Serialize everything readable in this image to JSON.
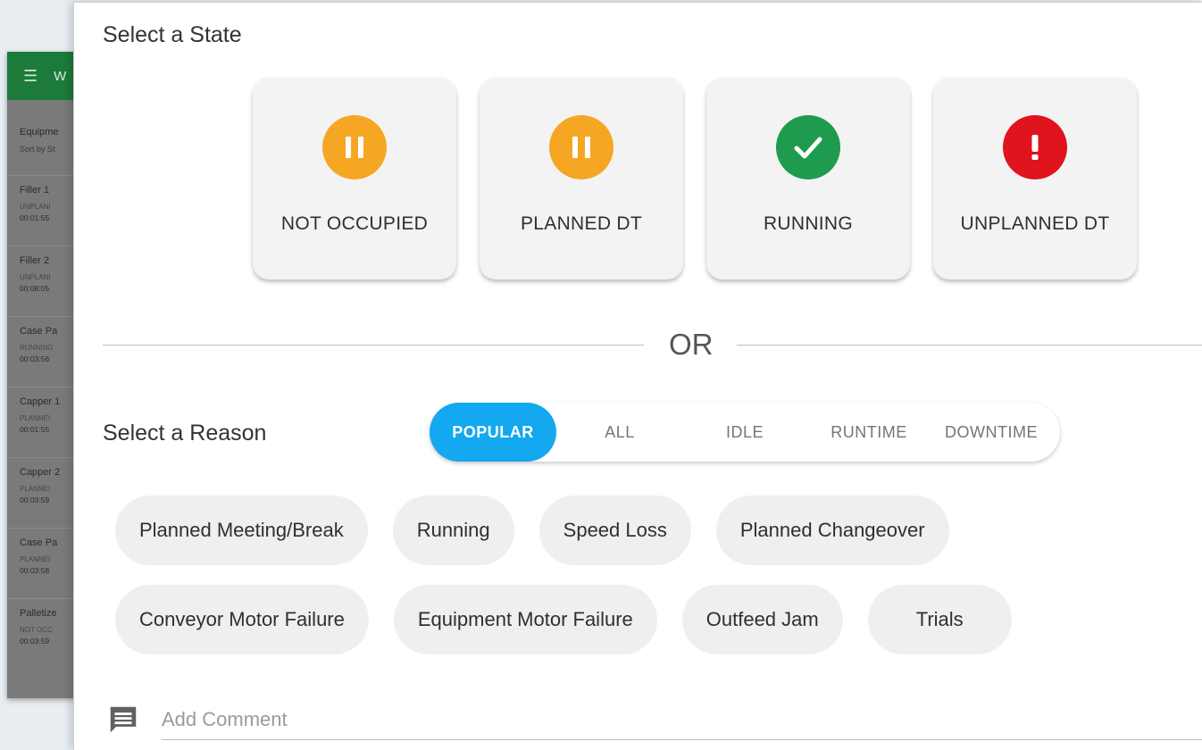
{
  "background_app": {
    "app_title": "W",
    "section_title": "Equipme",
    "sort_label": "Sort by St",
    "equipment": [
      {
        "name": "Filler 1",
        "state": "UNPLANI",
        "time": "00:01:55"
      },
      {
        "name": "Filler 2",
        "state": "UNPLANI",
        "time": "00:08:05"
      },
      {
        "name": "Case Pa",
        "state": "RUNNING",
        "time": "00:03:56"
      },
      {
        "name": "Capper 1",
        "state": "PLANNEI",
        "time": "00:01:55"
      },
      {
        "name": "Capper 2",
        "state": "PLANNEI",
        "time": "00:03:59"
      },
      {
        "name": "Case Pa",
        "state": "PLANNEI",
        "time": "00:03:58"
      },
      {
        "name": "Palletize",
        "state": "NOT OCC",
        "time": "00:03:59"
      }
    ]
  },
  "dialog": {
    "title": "Select a State",
    "states": [
      {
        "label": "NOT OCCUPIED",
        "icon": "pause-icon",
        "color": "#f5a623"
      },
      {
        "label": "PLANNED DT",
        "icon": "pause-icon",
        "color": "#f5a623"
      },
      {
        "label": "RUNNING",
        "icon": "check-icon",
        "color": "#1e9b4e"
      },
      {
        "label": "UNPLANNED DT",
        "icon": "exclamation-icon",
        "color": "#e0141c"
      }
    ],
    "divider_text": "OR",
    "reason_title": "Select a Reason",
    "tabs": [
      "POPULAR",
      "ALL",
      "IDLE",
      "RUNTIME",
      "DOWNTIME"
    ],
    "active_tab": "POPULAR",
    "accent_color": "#13a8ef",
    "reasons_row1": [
      "Planned Meeting/Break",
      "Running",
      "Speed Loss",
      "Planned Changeover"
    ],
    "reasons_row2": [
      "Conveyor Motor Failure",
      "Equipment Motor Failure",
      "Outfeed Jam",
      "Trials"
    ],
    "comment": {
      "placeholder": "Add Comment",
      "value": "",
      "icon": "comment-icon"
    }
  }
}
